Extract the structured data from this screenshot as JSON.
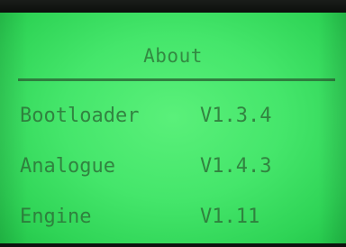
{
  "screen": {
    "title": "About",
    "rows": [
      {
        "name": "Bootloader",
        "version": "V1.3.4"
      },
      {
        "name": "Analogue",
        "version": "V1.4.3"
      },
      {
        "name": "Engine",
        "version": "V1.11"
      }
    ]
  },
  "colors": {
    "display_background": "#45e66b",
    "display_text": "#2e7339",
    "bezel": "#0c0f0c"
  }
}
